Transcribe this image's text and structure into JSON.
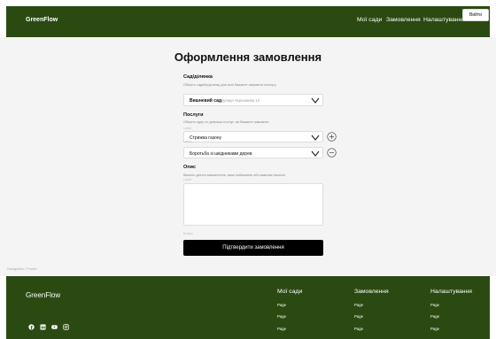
{
  "header": {
    "brand": "GreenFlow",
    "nav": [
      "Мої сади",
      "Замовлення",
      "Налаштування"
    ],
    "login_label": "Вийти"
  },
  "page": {
    "title": "Оформлення замовлення"
  },
  "form": {
    "garden": {
      "label": "Сад/ділянка",
      "hint": "Оберіть садибу/ділянку для якої бажаєте замовити послугу",
      "selected": "Вишневий сад",
      "address": "вулиця Черешнева 14"
    },
    "services": {
      "label": "Послуги",
      "hint": "Оберіть одну чи декілька послуг, які бажаєте замовити",
      "tiny_label": "Label",
      "items": [
        "Стрижка газону",
        "Боротьба зі шкідниками дерев"
      ]
    },
    "description": {
      "label": "Опис",
      "hint": "Вкажіть деталі замовлення, ваші побажання або важливі нюанси",
      "tiny_label": "Label"
    },
    "bottom_tiny_label": "Button",
    "submit_label": "Підтвердити замовлення"
  },
  "navigation_footer_label": "Navigation / Footer",
  "footer": {
    "brand": "GreenFlow",
    "columns": [
      {
        "title": "Мої сади",
        "pages": [
          "Page",
          "Page",
          "Page"
        ]
      },
      {
        "title": "Замовлення",
        "pages": [
          "Page",
          "Page",
          "Page"
        ]
      },
      {
        "title": "Налаштування",
        "pages": [
          "Page",
          "Page",
          "Page"
        ]
      }
    ],
    "social_icons": [
      "facebook-icon",
      "linkedin-icon",
      "youtube-icon",
      "instagram-icon"
    ]
  },
  "colors": {
    "brand_green": "#2b4a12",
    "page_bg": "#f4f4f4",
    "submit_bg": "#000000"
  }
}
